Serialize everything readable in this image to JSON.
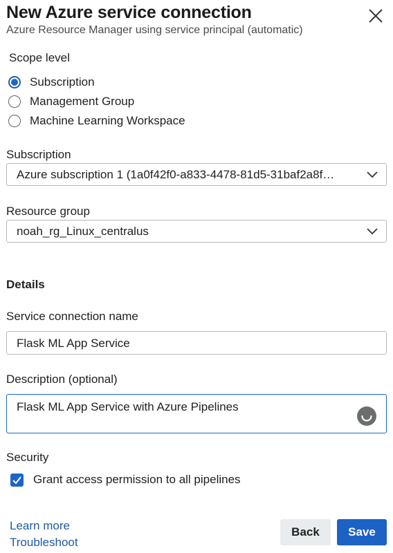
{
  "dialog": {
    "title": "New Azure service connection",
    "subtitle": "Azure Resource Manager using service principal (automatic)",
    "close_icon": "close-icon"
  },
  "scope": {
    "label": "Scope level",
    "options": [
      {
        "label": "Subscription",
        "checked": true
      },
      {
        "label": "Management Group",
        "checked": false
      },
      {
        "label": "Machine Learning Workspace",
        "checked": false
      }
    ]
  },
  "subscription": {
    "label": "Subscription",
    "value": "Azure subscription 1 (1a0f42f0-a833-4478-81d5-31baf2a8f…"
  },
  "resource_group": {
    "label": "Resource group",
    "value": "noah_rg_Linux_centralus"
  },
  "details": {
    "heading": "Details",
    "name_label": "Service connection name",
    "name_value": "Flask ML App Service",
    "description_label": "Description (optional)",
    "description_value": "Flask ML App Service with Azure Pipelines"
  },
  "security": {
    "label": "Security",
    "grant_label": "Grant access permission to all pipelines",
    "grant_checked": true
  },
  "footer": {
    "learn_more": "Learn more",
    "troubleshoot": "Troubleshoot",
    "back_label": "Back",
    "save_label": "Save"
  },
  "colors": {
    "accent": "#1c62c5",
    "link": "#1f5aa6",
    "back_button_bg": "#e9ecee"
  }
}
